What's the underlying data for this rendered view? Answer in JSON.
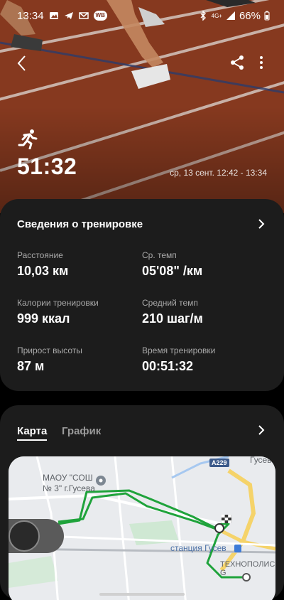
{
  "status_bar": {
    "time": "13:34",
    "wb_badge": "WB",
    "network": "4G+",
    "battery": "66%"
  },
  "workout": {
    "duration": "51:32",
    "date_range": "ср, 13 сент. 12:42 - 13:34"
  },
  "details": {
    "title": "Сведения о тренировке",
    "stats": [
      {
        "label": "Расстояние",
        "value": "10,03 км"
      },
      {
        "label": "Ср. темп",
        "value": "05'08\" /км"
      },
      {
        "label": "Калории тренировки",
        "value": "999 ккал"
      },
      {
        "label": "Средний темп",
        "value": "210 шаг/м"
      },
      {
        "label": "Прирост высоты",
        "value": "87 м"
      },
      {
        "label": "Время тренировки",
        "value": "00:51:32"
      }
    ]
  },
  "map_card": {
    "tabs": [
      "Карта",
      "График"
    ],
    "map_labels": {
      "school": "МАОУ \"СОШ\n№ 3\" г.Гусева",
      "road": "A229",
      "station": "станция Гусев",
      "tech": "ТЕХНОПОЛИС G",
      "city": "Гусев"
    }
  },
  "colors": {
    "track": "#8a3a25",
    "card_bg": "#1c1c1c",
    "route": "#1fa33b"
  }
}
